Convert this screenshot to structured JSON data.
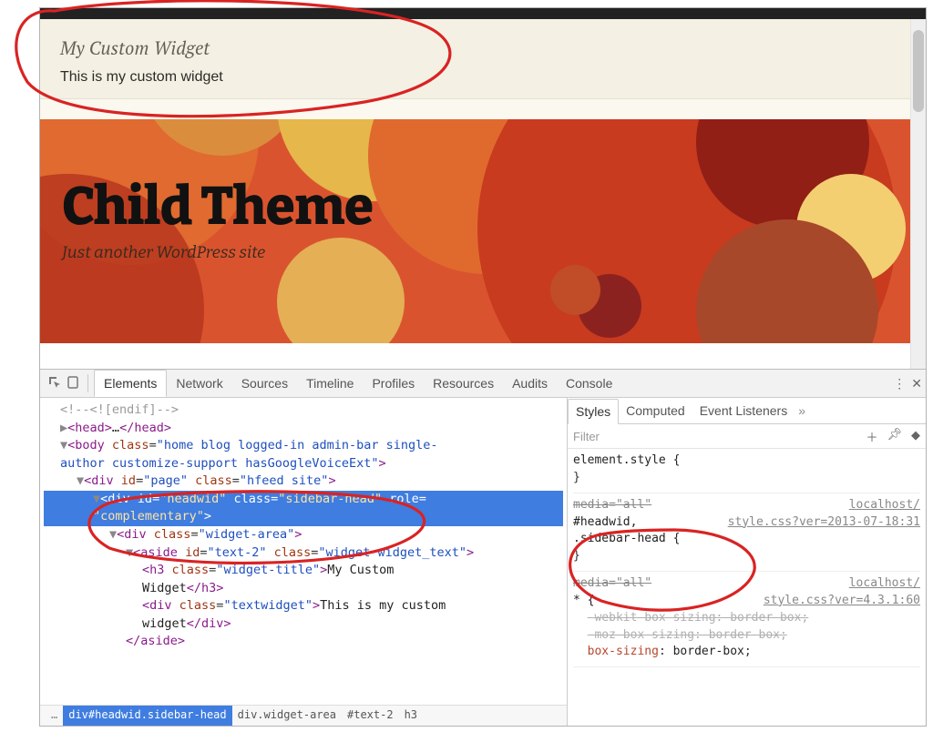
{
  "widget": {
    "title": "My Custom Widget",
    "body": "This is my custom widget"
  },
  "hero": {
    "title": "Child Theme",
    "tagline": "Just another WordPress site"
  },
  "devtools": {
    "tabs": [
      "Elements",
      "Network",
      "Sources",
      "Timeline",
      "Profiles",
      "Resources",
      "Audits",
      "Console"
    ],
    "active_tab": "Elements",
    "dom": {
      "comment": "<!--<![endif]-->",
      "head_open": "<head>",
      "head_ell": "…",
      "head_close": "</head>",
      "body_line1": "<body class=\"home blog logged-in admin-bar single-",
      "body_line2": "author customize-support hasGoogleVoiceExt\">",
      "page_div": "<div id=\"page\" class=\"hfeed site\">",
      "headwid_l1": "<div id=\"headwid\" class=\"sidebar-head\" role=",
      "headwid_l2": "\"complementary\">",
      "widgetarea": "<div class=\"widget-area\">",
      "aside": "<aside id=\"text-2\" class=\"widget widget_text\">",
      "h3_open": "<h3 class=\"widget-title\">",
      "h3_text": "My Custom Widget",
      "h3_close": "</h3>",
      "tw_open": "<div class=\"textwidget\">",
      "tw_text": "This is my custom widget",
      "tw_close": "</div>",
      "aside_close": "</aside>"
    },
    "breadcrumbs": [
      "…",
      "div#headwid.sidebar-head",
      "div.widget-area",
      "#text-2",
      "h3"
    ],
    "styles": {
      "tabs": [
        "Styles",
        "Computed",
        "Event Listeners"
      ],
      "active_tab": "Styles",
      "filter_placeholder": "Filter",
      "blocks": {
        "inline_sel": "element.style {",
        "b2_media": "media=\"all\"",
        "b2_origin": "localhost/",
        "b2_sel": "#headwid, .sidebar-head {",
        "b2_link": "style.css?ver=2013-07-18:31",
        "b3_media": "media=\"all\"",
        "b3_origin": "localhost/",
        "b3_sel": "* {",
        "b3_link": "style.css?ver=4.3.1:60",
        "b3_p1": "-webkit-box-sizing: border-box;",
        "b3_p2": "-moz-box-sizing: border-box;",
        "b3_p3_prop": "box-sizing",
        "b3_p3_val": "border-box"
      }
    }
  }
}
